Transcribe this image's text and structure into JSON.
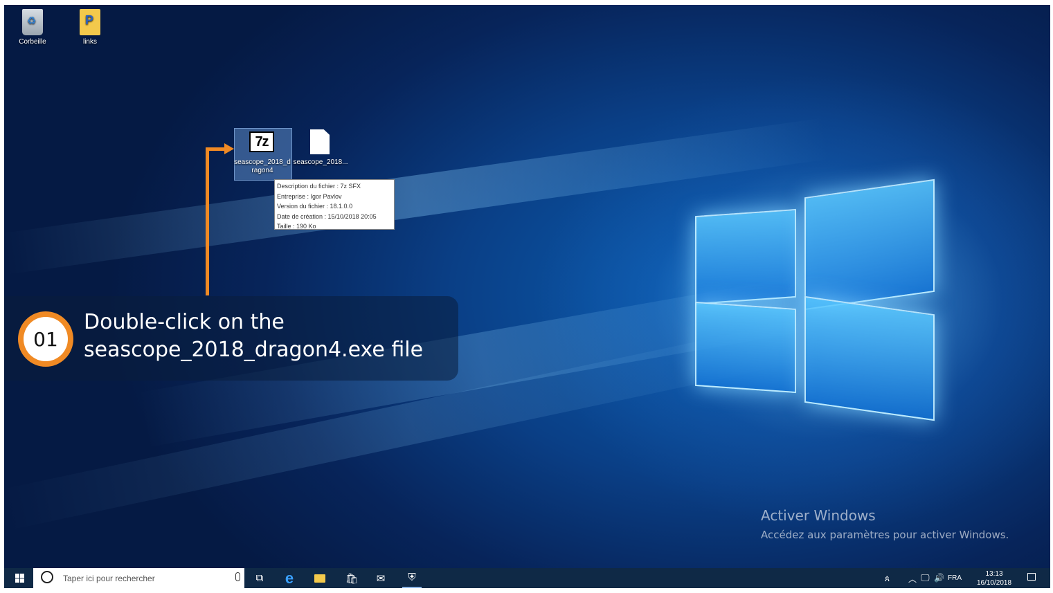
{
  "desktop_icons": [
    {
      "label": "Corbeille",
      "icon": "recycle-bin-icon"
    },
    {
      "label": "links",
      "icon": "folder-icon"
    }
  ],
  "files": [
    {
      "label_line1": "seascope_2018_d",
      "label_line2": "ragon4",
      "icon": "7z-archive-icon",
      "selected": true
    },
    {
      "label": "seascope_2018...",
      "icon": "blank-file-icon"
    }
  ],
  "tooltip": {
    "lines": [
      "Description du fichier : 7z SFX",
      "Entreprise : Igor Pavlov",
      "Version du fichier : 18.1.0.0",
      "Date de création : 15/10/2018 20:05",
      "Taille : 190 Ko"
    ]
  },
  "callout": {
    "step": "01",
    "line1": "Double-click on the",
    "line2": "seascope_2018_dragon4.exe file",
    "accent": "#f08a24"
  },
  "watermark": {
    "title": "Activer Windows",
    "subtitle": "Accédez aux paramètres pour activer Windows."
  },
  "taskbar": {
    "search_placeholder": "Taper ici pour rechercher",
    "language": "FRA",
    "time": "13:13",
    "date": "16/10/2018",
    "pinned": [
      "task-view-icon",
      "edge-icon",
      "file-explorer-icon",
      "store-icon",
      "mail-icon",
      "security-icon"
    ]
  }
}
